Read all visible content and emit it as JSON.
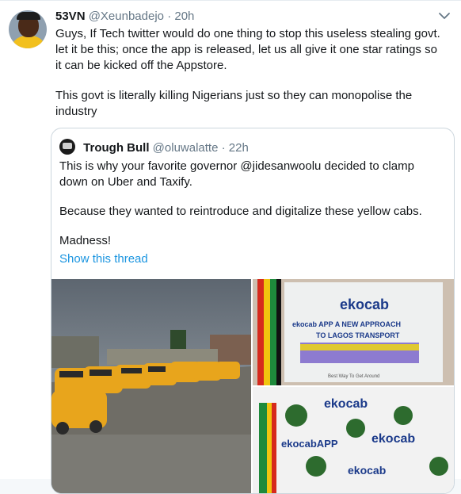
{
  "tweet": {
    "name": "53VN",
    "handle": "@Xeunbadejo",
    "separator": "·",
    "time": "20h",
    "paragraphs": [
      "Guys, If Tech twitter would do one thing to stop this useless stealing govt. let it be this; once the app is released, let us all give it one star ratings so it can be kicked off the Appstore.",
      "This govt is literally killing Nigerians just so they can monopolise the industry"
    ],
    "menu_icon": "chevron-down-icon"
  },
  "quoted": {
    "name": "Trough Bull",
    "handle": "@oluwalatte",
    "separator": "·",
    "time": "22h",
    "paragraphs": [
      "This is why your favorite governor @jidesanwoolu decided to clamp down on Uber and Taxify.",
      "Because they wanted to reintroduce and digitalize these yellow cabs.",
      "Madness!"
    ],
    "show_thread": "Show this thread",
    "link_color": "#1b95e0"
  },
  "media": {
    "banner_brand": "ekocab",
    "banner_line1": "ekocab APP A NEW APPROACH",
    "banner_line2": "TO LAGOS TRANSPORT",
    "banner_tagline": "Best Way To Get Around",
    "banner2_brand_a": "ekocab",
    "banner2_brand_b": "ekocab",
    "banner2_brand_c": "ekocab",
    "banner2_app": "ekocabAPP"
  }
}
